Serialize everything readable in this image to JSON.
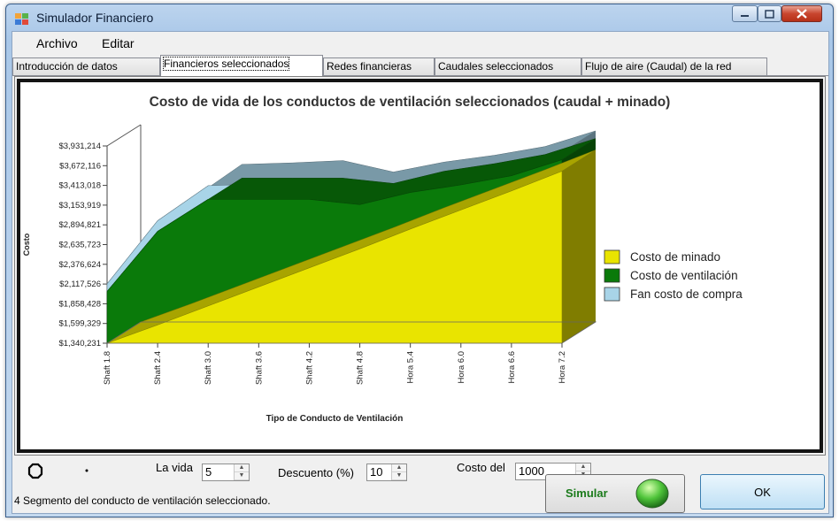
{
  "window": {
    "title": "Simulador Financiero"
  },
  "menu": {
    "items": [
      "Archivo",
      "Editar"
    ]
  },
  "tabs": [
    "Introducción de datos",
    "Financieros seleccionados",
    "Redes financieras",
    "Caudales seleccionados",
    "Flujo de aire (Caudal)  de la red"
  ],
  "active_tab": "Financieros seleccionados",
  "chart_data": {
    "type": "area",
    "title": "Costo de vida de los conductos de ventilación seleccionados (caudal + minado)",
    "xlabel": "Tipo de Conducto de Ventilación",
    "ylabel": "Costo",
    "categories": [
      "Shaft 1.8",
      "Shaft 2.4",
      "Shaft 3.0",
      "Shaft 3.6",
      "Shaft 4.2",
      "Shaft 4.8",
      "Hora 5.4",
      "Hora 6.0",
      "Hora 6.6",
      "Hora 7.2"
    ],
    "y_ticks": [
      "$1,340,231",
      "$1,599,329",
      "$1,858,428",
      "$2,117,526",
      "$2,376,624",
      "$2,635,723",
      "$2,894,821",
      "$3,153,919",
      "$3,413,018",
      "$3,672,116",
      "$3,931,214"
    ],
    "ylim": [
      1340231,
      3931214
    ],
    "stacked": true,
    "three_d": true,
    "series": [
      {
        "name": "Costo de minado",
        "color": "#e9e400",
        "values": [
          1340231,
          1580000,
          1830000,
          2080000,
          2330000,
          2580000,
          2840000,
          3090000,
          3340000,
          3600000
        ]
      },
      {
        "name": "Costo de ventilación",
        "color": "#0a7a0a",
        "values": [
          680000,
          1230000,
          1400000,
          1150000,
          900000,
          580000,
          480000,
          330000,
          200000,
          150000
        ]
      },
      {
        "name": "Fan costo de compra",
        "color": "#a8d4e8",
        "values": [
          100000,
          140000,
          180000,
          200000,
          230000,
          150000,
          120000,
          110000,
          105000,
          100000
        ]
      }
    ],
    "legend_position": "right"
  },
  "controls": {
    "la_vida_label": "La vida",
    "la_vida_value": "5",
    "descuento_label": "Descuento (%)",
    "descuento_value": "10",
    "costo_label": "Costo del",
    "costo_value": "1000",
    "status_text": "4 Segmento del conducto de ventilación seleccionado.",
    "simular_label": "Simular",
    "ok_label": "OK"
  }
}
